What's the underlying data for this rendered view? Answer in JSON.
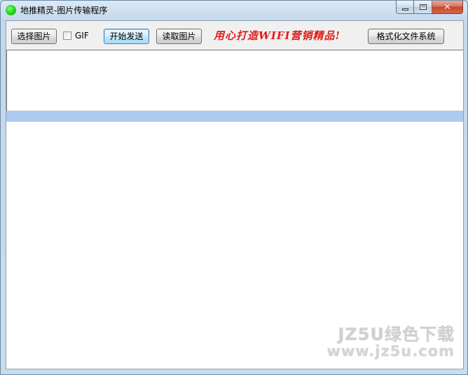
{
  "window": {
    "title": "地推精灵-图片传输程序",
    "icon": "green-circle-icon",
    "caption": {
      "minimize_icon": "minimize-icon",
      "maximize_icon": "maximize-icon",
      "close_icon": "close-icon",
      "close_glyph": "✕"
    }
  },
  "toolbar": {
    "select_image_label": "选择图片",
    "gif_label": "GIF",
    "gif_checked": false,
    "start_send_label": "开始发送",
    "read_image_label": "读取图片",
    "slogan": "用心打造WIFI营销精品!",
    "format_fs_label": "格式化文件系统"
  },
  "watermark": {
    "line1": "JZ5U绿色下载",
    "line2": "www.jz5u.com"
  },
  "colors": {
    "slogan": "#e11b1b",
    "selection": "#accbee",
    "icon_green": "#1bd21b"
  }
}
